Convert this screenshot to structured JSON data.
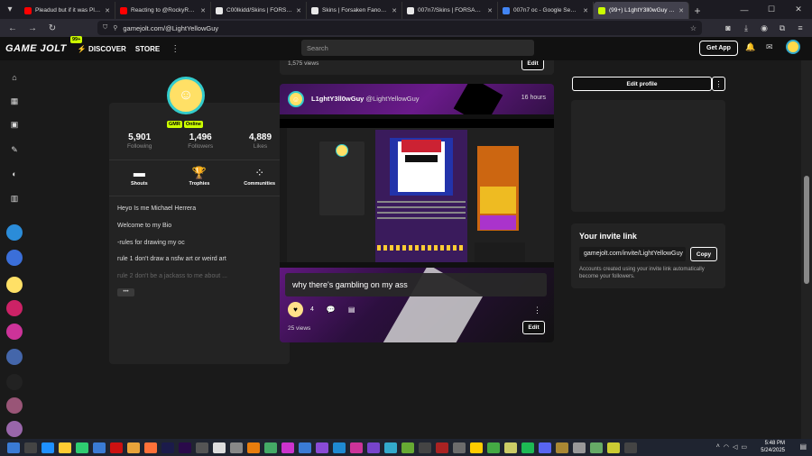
{
  "browser": {
    "tabs": [
      {
        "title": "Pleadud but if it was Plead (aka",
        "favicon_color": "#ff0000",
        "active": false
      },
      {
        "title": "Reacting to @RockyRakoon",
        "favicon_color": "#ff0000",
        "active": false
      },
      {
        "title": "C00lkidd/Skins | FORSAKEN Wi",
        "favicon_color": "#e8e8e8",
        "active": false
      },
      {
        "title": "Skins | Forsaken Fanon Wiki | F",
        "favicon_color": "#e8e8e8",
        "active": false
      },
      {
        "title": "007n7/Skins | FORSAKEN Wiki |",
        "favicon_color": "#e8e8e8",
        "active": false
      },
      {
        "title": "007n7 oc - Google Search",
        "favicon_color": "#4285f4",
        "active": false
      },
      {
        "title": "(99+) L1ghtY3ll0wGuy (@Light",
        "favicon_color": "#ccff00",
        "active": true
      }
    ],
    "url": "gamejolt.com/@LightYellowGuy"
  },
  "site": {
    "logo": "GAME JOLT",
    "badge": "99+",
    "nav_discover": "DISCOVER",
    "nav_store": "STORE",
    "search_placeholder": "Search",
    "get_app": "Get App"
  },
  "profile": {
    "tags": [
      "GMR",
      "Online"
    ],
    "stats": [
      {
        "value": "5,901",
        "label": "Following"
      },
      {
        "value": "1,496",
        "label": "Followers"
      },
      {
        "value": "4,889",
        "label": "Likes"
      }
    ],
    "actions": [
      {
        "label": "Shouts",
        "icon": "chat-bubble-icon"
      },
      {
        "label": "Trophies",
        "icon": "trophy-icon"
      },
      {
        "label": "Communities",
        "icon": "communities-icon"
      }
    ],
    "bio": [
      "Heyo Is me Michael Herrera",
      "Welcome to my Bio",
      "-rules for drawing my oc",
      "rule 1 don't draw a nsfw art or weird art",
      "rule 2 don't be a jackass to me about ..."
    ],
    "more_label": "•••"
  },
  "feed": {
    "prev_views": "1,575 views",
    "edit_label": "Edit",
    "post": {
      "username": "L1ghtY3ll0wGuy",
      "handle": "@LightYellowGuy",
      "time": "16 hours",
      "caption": "why there's gambling on my ass",
      "likes": "4",
      "views": "25 views"
    }
  },
  "sidebar_right": {
    "edit_profile": "Edit profile",
    "invite_title": "Your invite link",
    "invite_url": "gamejolt.com/invite/LightYellowGuy",
    "copy_label": "Copy",
    "invite_note": "Accounts created using your invite link automatically become your followers."
  },
  "taskbar": {
    "time": "5:48 PM",
    "date": "5/24/2025"
  }
}
